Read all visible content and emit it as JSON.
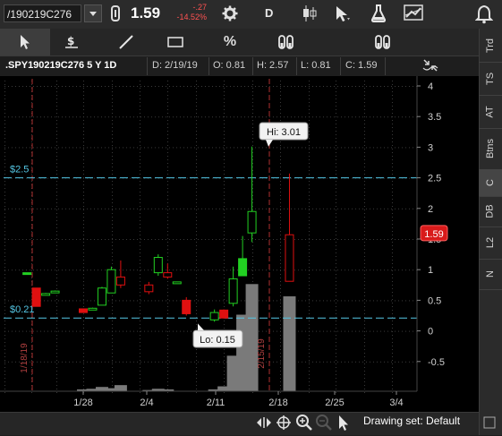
{
  "symbol_bar": {
    "symbol": "/190219C276",
    "last": "1.59",
    "net_change": "-.27",
    "percent_change": "-14.52%",
    "period": "D"
  },
  "toolbar": {
    "percent_label": "%"
  },
  "side_tabs": [
    "Trd",
    "TS",
    "AT",
    "Btns",
    "C",
    "DB",
    "L2",
    "N"
  ],
  "chart_header": {
    "title": ".SPY190219C276 5 Y 1D",
    "date": "D: 2/19/19",
    "open": "O: 0.81",
    "high": "H: 2.57",
    "low": "L: 0.81",
    "close": "C: 1.59"
  },
  "status": {
    "drawing_set": "Drawing set: Default"
  },
  "colors": {
    "up": "#22d022",
    "down": "#e01010",
    "price_line": "#55c8e6",
    "expiry_line": "#b03030",
    "last_tag": "#d81a1a",
    "volume": "#7a7a7a"
  },
  "chart_data": {
    "type": "candlestick",
    "price_axis": {
      "ticks": [
        "4",
        "3.5",
        "3",
        "2.5",
        "2",
        "1.5",
        "1",
        "0.5",
        "0",
        "-0.5"
      ],
      "ylim": [
        -0.95,
        4.2
      ]
    },
    "date_axis": [
      "1/28",
      "2/4",
      "2/11",
      "2/18",
      "2/25",
      "3/4"
    ],
    "price_lines": [
      {
        "label": "$2.5",
        "value": 2.5
      },
      {
        "label": "$0.21",
        "value": 0.21
      }
    ],
    "expiry_markers": [
      "1/18/19",
      "2/15/19"
    ],
    "callouts": [
      {
        "label": "Hi: 3.01",
        "value": 3.01
      },
      {
        "label": "Lo: 0.15",
        "value": 0.15
      }
    ],
    "last_tag": "1.59",
    "last_value": 1.59,
    "candles": [
      {
        "date": "1/22",
        "o": 0.95,
        "h": 0.95,
        "l": 0.93,
        "c": 0.94,
        "dir": "up"
      },
      {
        "date": "1/23",
        "o": 0.7,
        "h": 0.7,
        "l": 0.4,
        "c": 0.4,
        "dir": "down"
      },
      {
        "date": "1/24",
        "o": 0.6,
        "h": 0.62,
        "l": 0.59,
        "c": 0.61,
        "dir": "up"
      },
      {
        "date": "1/25",
        "o": 0.65,
        "h": 0.66,
        "l": 0.64,
        "c": 0.65,
        "dir": "up"
      },
      {
        "date": "1/28",
        "o": 0.36,
        "h": 0.36,
        "l": 0.3,
        "c": 0.3,
        "dir": "down"
      },
      {
        "date": "1/29",
        "o": 0.37,
        "h": 0.38,
        "l": 0.36,
        "c": 0.37,
        "dir": "up"
      },
      {
        "date": "1/30",
        "o": 0.42,
        "h": 0.72,
        "l": 0.42,
        "c": 0.7,
        "dir": "up"
      },
      {
        "date": "1/31",
        "o": 0.62,
        "h": 1.05,
        "l": 0.62,
        "c": 1.0,
        "dir": "up"
      },
      {
        "date": "2/1",
        "o": 0.88,
        "h": 1.15,
        "l": 0.7,
        "c": 0.75,
        "dir": "down"
      },
      {
        "date": "2/4",
        "o": 0.75,
        "h": 0.8,
        "l": 0.6,
        "c": 0.64,
        "dir": "down"
      },
      {
        "date": "2/5",
        "o": 0.95,
        "h": 1.25,
        "l": 0.9,
        "c": 1.2,
        "dir": "up"
      },
      {
        "date": "2/6",
        "o": 0.95,
        "h": 1.1,
        "l": 0.85,
        "c": 0.88,
        "dir": "down"
      },
      {
        "date": "2/7",
        "o": 0.8,
        "h": 0.8,
        "l": 0.79,
        "c": 0.8,
        "dir": "up"
      },
      {
        "date": "2/8",
        "o": 0.5,
        "h": 0.55,
        "l": 0.25,
        "c": 0.28,
        "dir": "down"
      },
      {
        "date": "2/11",
        "o": 0.18,
        "h": 0.35,
        "l": 0.15,
        "c": 0.3,
        "dir": "up"
      },
      {
        "date": "2/12",
        "o": 0.34,
        "h": 0.35,
        "l": 0.2,
        "c": 0.21,
        "dir": "down"
      },
      {
        "date": "2/13",
        "o": 0.45,
        "h": 1.05,
        "l": 0.4,
        "c": 0.85,
        "dir": "up"
      },
      {
        "date": "2/14",
        "o": 0.9,
        "h": 1.55,
        "l": 0.9,
        "c": 1.18,
        "dir": "up"
      },
      {
        "date": "2/15",
        "o": 1.95,
        "h": 3.01,
        "l": 1.45,
        "c": 1.6,
        "dir": "up"
      },
      {
        "date": "2/19",
        "o": 1.57,
        "h": 2.57,
        "l": 0.81,
        "c": 0.81,
        "dir": "down"
      }
    ],
    "volume": [
      {
        "date": "1/28",
        "v": 0.03
      },
      {
        "date": "1/29",
        "v": 0.04
      },
      {
        "date": "1/30",
        "v": 0.07
      },
      {
        "date": "1/31",
        "v": 0.05
      },
      {
        "date": "2/1",
        "v": 0.1
      },
      {
        "date": "2/4",
        "v": 0.02
      },
      {
        "date": "2/5",
        "v": 0.04
      },
      {
        "date": "2/6",
        "v": 0.03
      },
      {
        "date": "2/11",
        "v": 0.03
      },
      {
        "date": "2/12",
        "v": 0.08
      },
      {
        "date": "2/13",
        "v": 0.58
      },
      {
        "date": "2/14",
        "v": 1.25
      },
      {
        "date": "2/15",
        "v": 1.75
      },
      {
        "date": "2/19",
        "v": 1.55
      }
    ]
  }
}
